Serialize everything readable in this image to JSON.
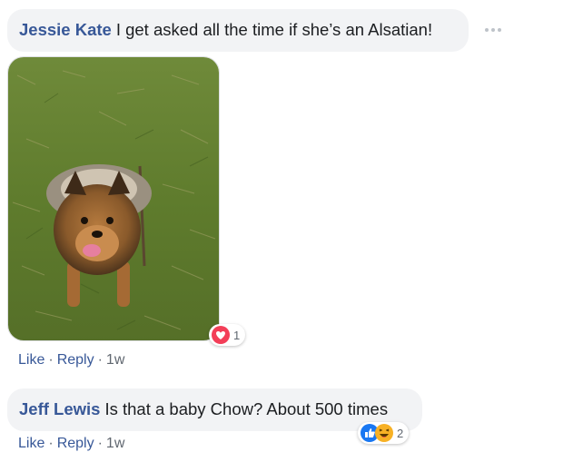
{
  "comments": [
    {
      "author": "Jessie Kate",
      "text": "I get asked all the time if she’s an Alsatian!",
      "reactions": {
        "icons": [
          "love-icon"
        ],
        "count": "1"
      },
      "actions": {
        "like": "Like",
        "reply": "Reply",
        "time": "1w",
        "separator": "·"
      }
    },
    {
      "author": "Jeff Lewis",
      "text": "Is that a baby Chow? About 500 times",
      "reactions": {
        "icons": [
          "like-icon",
          "haha-icon"
        ],
        "count": "2"
      },
      "actions": {
        "like": "Like",
        "reply": "Reply",
        "time": "1w",
        "separator": "·"
      }
    }
  ],
  "colors": {
    "author": "#385898",
    "bubble": "#f2f3f5",
    "meta": "#606770",
    "love": "#f33e58",
    "like": "#1877f2",
    "haha": "#f7b125"
  },
  "more_options_icon": "more-horizontal-icon"
}
